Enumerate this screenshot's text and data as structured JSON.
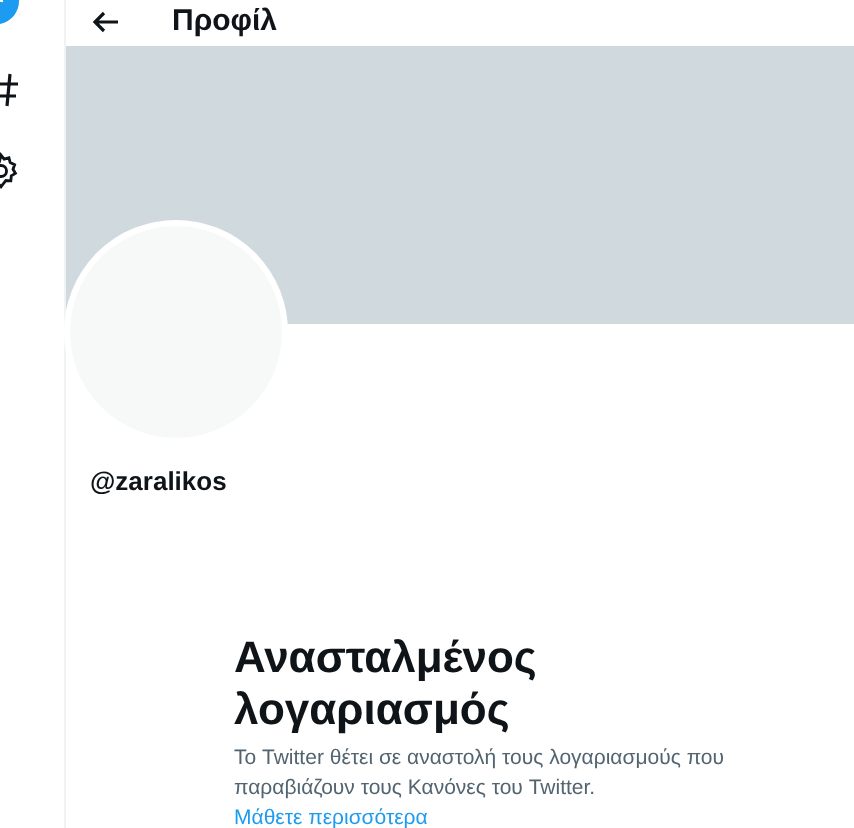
{
  "header": {
    "title": "Προφίλ"
  },
  "profile": {
    "handle": "@zaralikos"
  },
  "notice": {
    "title": "Ανασταλμένος λογαριασμός",
    "message": "Το Twitter θέτει σε αναστολή τους λογαριασμούς που παραβιάζουν τους Κανόνες του Twitter.",
    "link": "Μάθετε περισσότερα"
  }
}
